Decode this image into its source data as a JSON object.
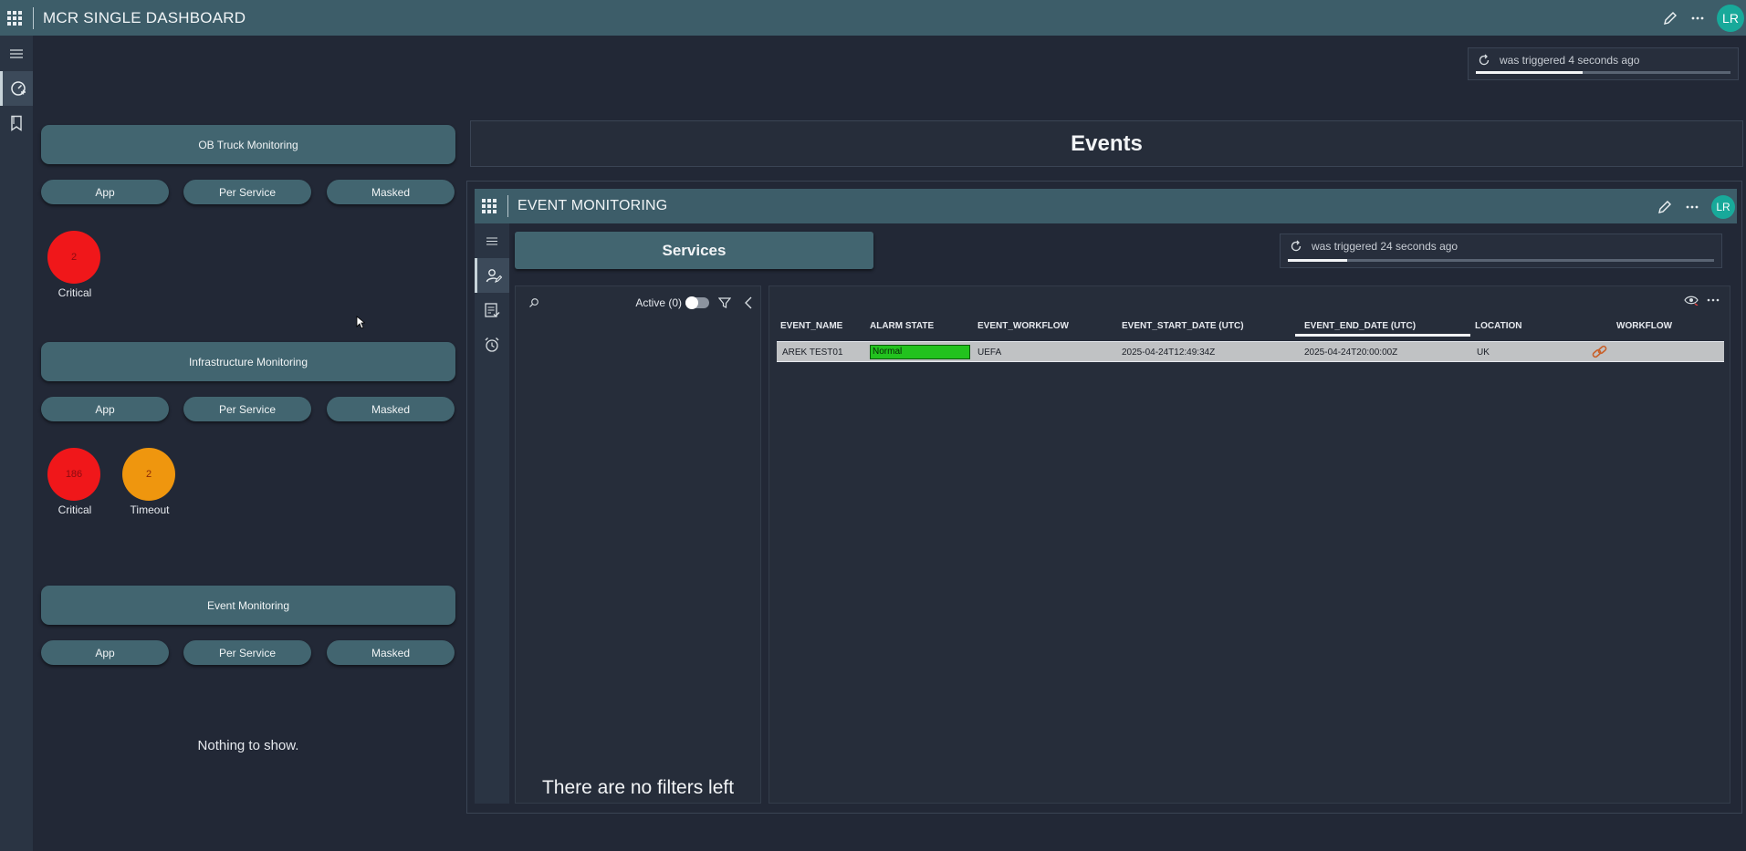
{
  "app": {
    "title": "MCR SINGLE DASHBOARD",
    "avatar_initials": "LR"
  },
  "trigger_main": {
    "text": "was triggered 4 seconds ago",
    "progress": 0.42
  },
  "sections": [
    {
      "title": "OB Truck Monitoring",
      "buttons": [
        "App",
        "Per Service",
        "Masked"
      ],
      "bubbles": [
        {
          "value": "2",
          "label": "Critical",
          "color": "#f0171a"
        }
      ]
    },
    {
      "title": "Infrastructure Monitoring",
      "buttons": [
        "App",
        "Per Service",
        "Masked"
      ],
      "bubbles": [
        {
          "value": "186",
          "label": "Critical",
          "color": "#f0171a"
        },
        {
          "value": "2",
          "label": "Timeout",
          "color": "#ef960e"
        }
      ]
    },
    {
      "title": "Event Monitoring",
      "buttons": [
        "App",
        "Per Service",
        "Masked"
      ],
      "empty_text": "Nothing to show."
    }
  ],
  "events": {
    "header": "Events",
    "embed_title": "EVENT MONITORING",
    "avatar_initials": "LR",
    "services_label": "Services",
    "trigger": {
      "text": "was triggered 24 seconds ago",
      "progress": 0.14
    },
    "filter": {
      "active_label": "Active (0)",
      "empty_text": "There are no filters left"
    },
    "table": {
      "columns": [
        "EVENT_NAME",
        "ALARM STATE",
        "EVENT_WORKFLOW",
        "EVENT_START_DATE (UTC)",
        "EVENT_END_DATE (UTC)",
        "LOCATION",
        "WORKFLOW"
      ],
      "rows": [
        [
          "AREK TEST01",
          "Normal",
          "UEFA",
          "2025-04-24T12:49:34Z",
          "2025-04-24T20:00:00Z",
          "UK",
          ""
        ]
      ],
      "sorted_column": "EVENT_END_DATE (UTC)"
    }
  },
  "colors": {
    "accent": "#3d5d69",
    "button": "#426570",
    "critical": "#f0171a",
    "timeout": "#ef960e",
    "normal": "#22c21e"
  }
}
